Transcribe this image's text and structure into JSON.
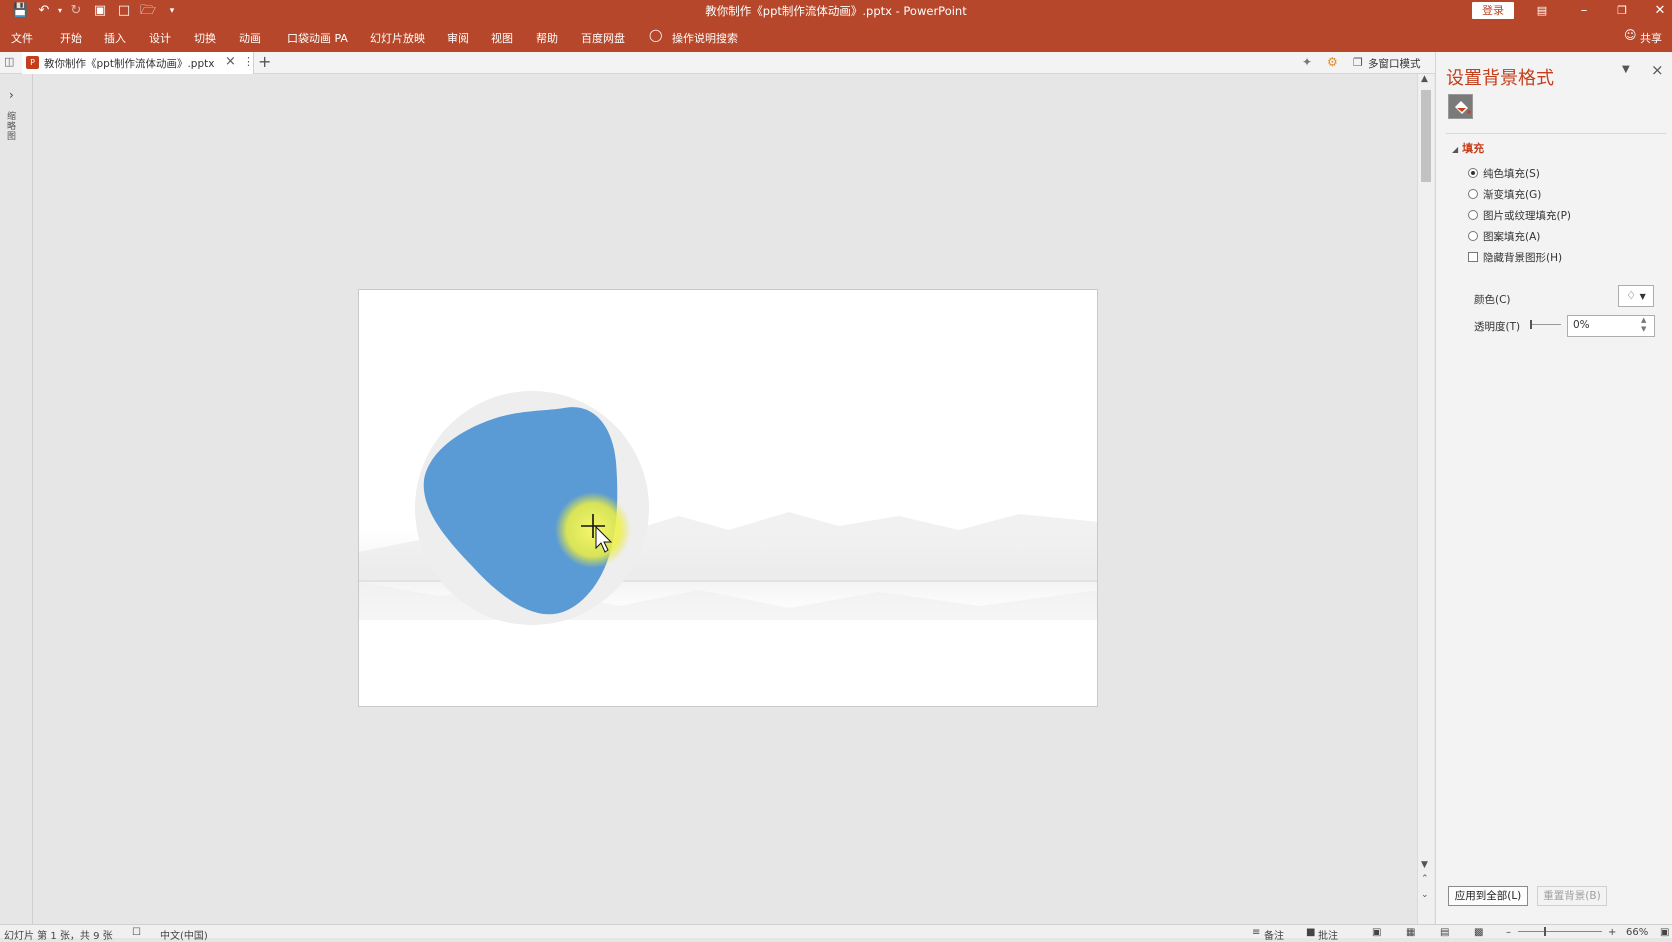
{
  "window": {
    "title": "教你制作《ppt制作流体动画》.pptx  -  PowerPoint",
    "login_label": "登录",
    "quick_access_icons": [
      "save-icon",
      "undo-icon",
      "redo-icon",
      "presenter-icon",
      "new-file-icon",
      "open-folder-icon",
      "customize-icon"
    ]
  },
  "ribbon": {
    "tabs": [
      "文件",
      "开始",
      "插入",
      "设计",
      "切换",
      "动画",
      "口袋动画 PA",
      "幻灯片放映",
      "审阅",
      "视图",
      "帮助",
      "百度网盘"
    ],
    "tell_me": "操作说明搜索",
    "share": "共享"
  },
  "doc_tabs": {
    "active_tab": "教你制作《ppt制作流体动画》.pptx",
    "multi_window": "多窗口模式"
  },
  "left_pane": {
    "label": "缩略图"
  },
  "format_pane": {
    "title": "设置背景格式",
    "section": "填充",
    "options": [
      {
        "label": "纯色填充(S)",
        "selected": true
      },
      {
        "label": "渐变填充(G)",
        "selected": false
      },
      {
        "label": "图片或纹理填充(P)",
        "selected": false
      },
      {
        "label": "图案填充(A)",
        "selected": false
      }
    ],
    "hide_bg_label": "隐藏背景图形(H)",
    "color_label": "颜色(C)",
    "transparency_label": "透明度(T)",
    "transparency_value": "0%",
    "apply_all": "应用到全部(L)",
    "reset_bg": "重置背景(B)"
  },
  "status": {
    "slide_info": "幻灯片 第 1 张，共 9 张",
    "language": "中文(中国)",
    "notes": "备注",
    "comments": "批注",
    "zoom": "66%"
  },
  "colors": {
    "accent": "#b7472a",
    "blob": "#5b9bd5",
    "cursor_highlight": "#f3f54a"
  }
}
